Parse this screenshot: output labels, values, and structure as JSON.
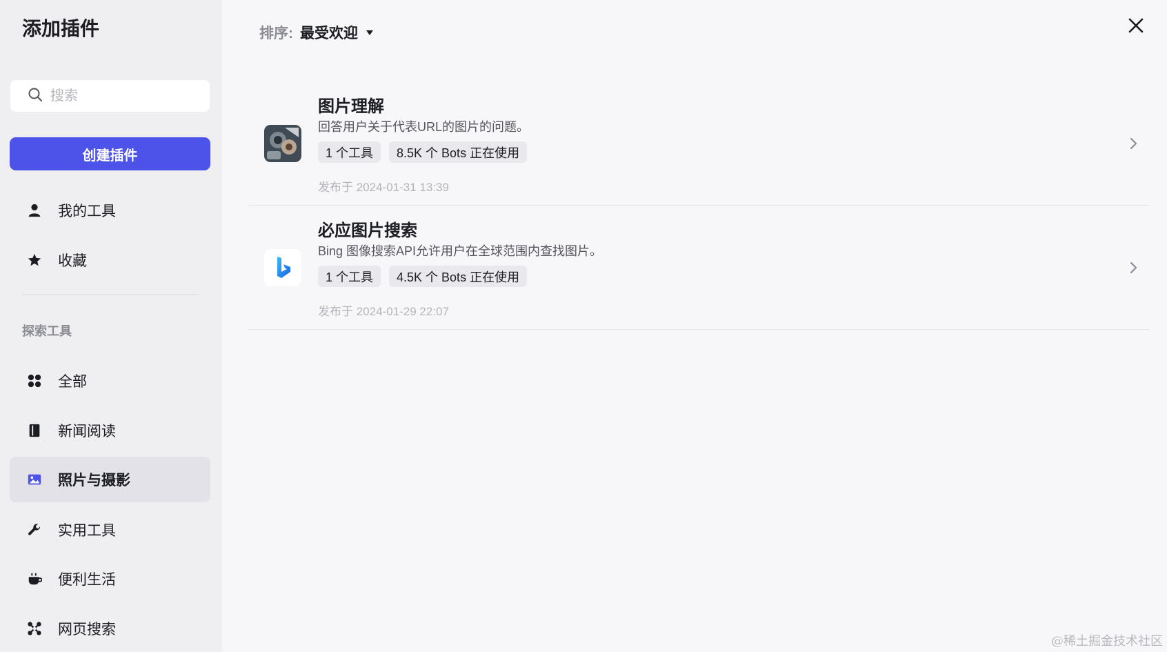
{
  "sidebar": {
    "title": "添加插件",
    "search": {
      "placeholder": "搜索",
      "value": ""
    },
    "create_label": "创建插件",
    "my_items": [
      {
        "label": "我的工具",
        "icon": "user-icon"
      },
      {
        "label": "收藏",
        "icon": "star-icon"
      }
    ],
    "explore_label": "探索工具",
    "categories": [
      {
        "label": "全部",
        "icon": "grid-icon",
        "active": false
      },
      {
        "label": "新闻阅读",
        "icon": "book-icon",
        "active": false
      },
      {
        "label": "照片与摄影",
        "icon": "image-icon",
        "active": true
      },
      {
        "label": "实用工具",
        "icon": "wrench-icon",
        "active": false
      },
      {
        "label": "便利生活",
        "icon": "cup-icon",
        "active": false
      },
      {
        "label": "网页搜索",
        "icon": "network-icon",
        "active": false
      }
    ]
  },
  "main": {
    "sort_label": "排序:",
    "sort_value": "最受欢迎",
    "plugins": [
      {
        "name": "图片理解",
        "description": "回答用户关于代表URL的图片的问题。",
        "tags": [
          "1 个工具",
          "8.5K 个 Bots 正在使用"
        ],
        "date": "发布于 2024-01-31 13:39",
        "icon": "image-understanding-icon"
      },
      {
        "name": "必应图片搜索",
        "description": "Bing 图像搜索API允许用户在全球范围内查找图片。",
        "tags": [
          "1 个工具",
          "4.5K 个 Bots 正在使用"
        ],
        "date": "发布于 2024-01-29 22:07",
        "icon": "bing-icon"
      }
    ]
  },
  "watermark": "@稀土掘金技术社区",
  "colors": {
    "accent": "#4d53e8",
    "sidebar_bg": "#efeff2",
    "main_bg": "#f7f7f9"
  }
}
